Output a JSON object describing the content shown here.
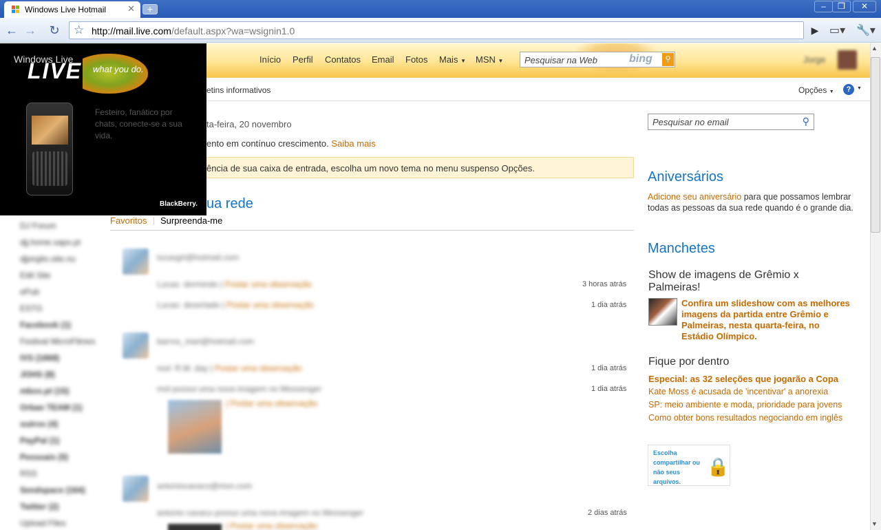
{
  "browser": {
    "tab_title": "Windows Live Hotmail",
    "url_host": "http://mail.live.com",
    "url_path": "/default.aspx?wa=wsignin1.0"
  },
  "topnav": {
    "items": [
      "Início",
      "Perfil",
      "Contatos",
      "Email",
      "Fotos",
      "Mais",
      "MSN"
    ],
    "search_placeholder": "Pesquisar na Web",
    "search_brand": "bing",
    "user_name": "Jorge"
  },
  "subnav": {
    "link": "etins informativos",
    "options": "Opções",
    "help": "?"
  },
  "main": {
    "date_text": "ta-feira, 20 novembro",
    "growth_text": "ento em contínuo crescimento.",
    "growth_link": "Saiba mais",
    "theme_notice": "ência de sua caixa de entrada, escolha um novo tema no menu suspenso Opções.",
    "network_heading": "ua rede",
    "tab_favorites": "Favoritos",
    "tab_surprise": "Surpreenda-me",
    "feed": [
      {
        "email": "lucasgrt@hotmail.com",
        "lines": [
          {
            "text": "Lucas: dormindo |",
            "link": "Postar uma observação",
            "time": "3 horas atrás"
          },
          {
            "text": "Lucas: deserlado |",
            "link": "Postar uma observação",
            "time": "1 dia atrás"
          }
        ]
      },
      {
        "email": "barros_mari@hotmail.com",
        "lines": [
          {
            "text": "mol: R.M. day |",
            "link": "Postar uma observação",
            "time": "1 dia atrás"
          },
          {
            "text": "mol possui uma nova imagem no Messenger",
            "link": "",
            "time": "1 dia atrás"
          }
        ],
        "photo_link": "| Postar uma observação"
      },
      {
        "email": "antoniocavaco@msn.com",
        "lines": [
          {
            "text": "antonio cavaco possui uma nova imagem no Messenger",
            "link": "",
            "time": "2 dias atrás"
          }
        ],
        "photo_link": "| Postar uma observação"
      }
    ]
  },
  "sidebar_folders": [
    "DJ Forum",
    "djj.home.sapo.pt",
    "djjorgito.site.nu",
    "Edit Site",
    "ePub",
    "ESTG",
    "Facebook (1)",
    "Festival MicroFilmes",
    "IVS (1668)",
    "JOHS (8)",
    "mbox.pt (15)",
    "Orban TEAM (1)",
    "outros (4)",
    "PayPal (1)",
    "Pessoais (5)",
    "RSS",
    "Sendspace (164)",
    "Twitter (2)",
    "Upload Files"
  ],
  "right": {
    "mail_search_placeholder": "Pesquisar no email",
    "birthdays_heading": "Aniversários",
    "birthdays_link": "Adicione seu aniversário",
    "birthdays_text": "para que possamos lembrar todas as pessoas da sua rede quando é o grande dia.",
    "headlines_heading": "Manchetes",
    "headline_title": "Show de imagens de Grêmio x Palmeiras!",
    "headline_link": "Confira um slideshow com as melhores imagens da partida entre Grêmio e Palmeiras, nesta quarta-feira, no Estádio Olímpico.",
    "stay_heading": "Fique por dentro",
    "stay_links": [
      "Especial: as 32 seleções que jogarão a Copa",
      "Kate Moss é acusada de 'incentivar' a anorexia",
      "SP: meio ambiente e moda, prioridade para jovens",
      "Como obter bons resultados negociando em inglês"
    ],
    "share_box_text": "Escolha compartilhar ou não seus arquivos."
  },
  "ad": {
    "windows_live": "Windows Live",
    "tagline": "what you do.",
    "text": "Festeiro, fanático por chats, conecte-se a sua vida.",
    "brand": "BlackBerry."
  },
  "colors": {
    "accent_blue": "#1574c4",
    "link_orange": "#c46a00",
    "header_yellow": "#ffe79a"
  }
}
